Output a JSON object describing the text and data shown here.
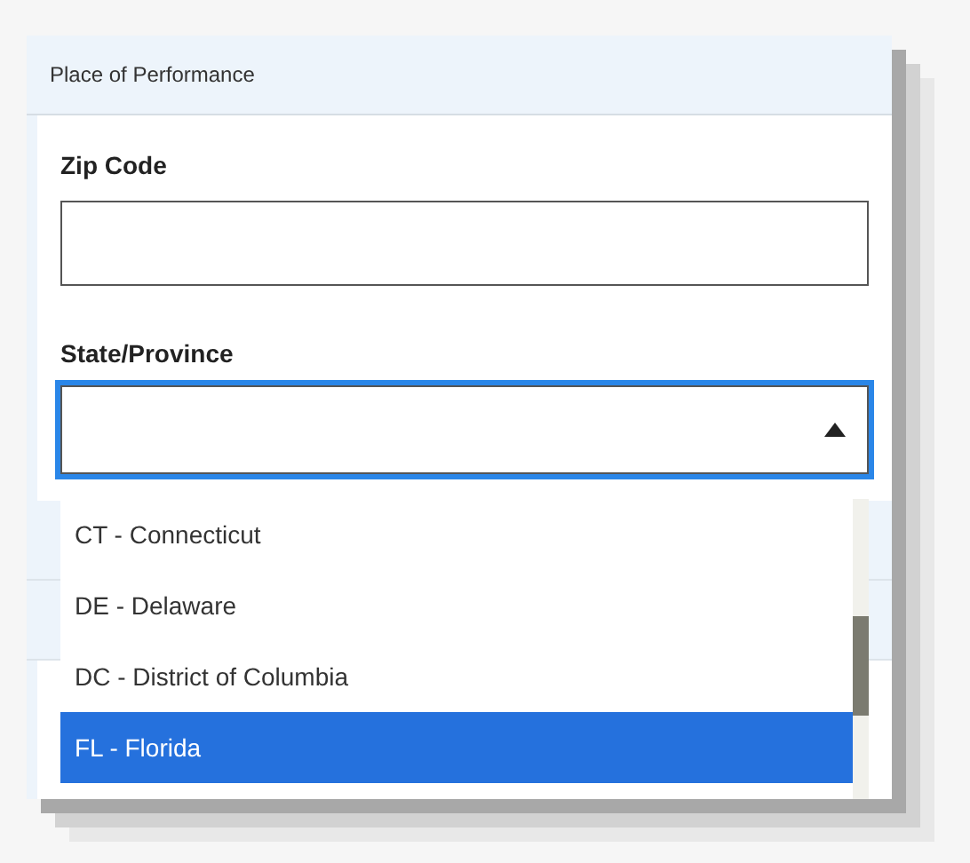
{
  "panel": {
    "title": "Place of Performance"
  },
  "zip_code": {
    "label": "Zip Code"
  },
  "state_province": {
    "label": "State/Province",
    "expanded": true,
    "options": [
      {
        "label": "CT - Connecticut",
        "selected": false
      },
      {
        "label": "DE - Delaware",
        "selected": false
      },
      {
        "label": "DC - District of Columbia",
        "selected": false
      },
      {
        "label": "FL - Florida",
        "selected": true
      }
    ]
  }
}
